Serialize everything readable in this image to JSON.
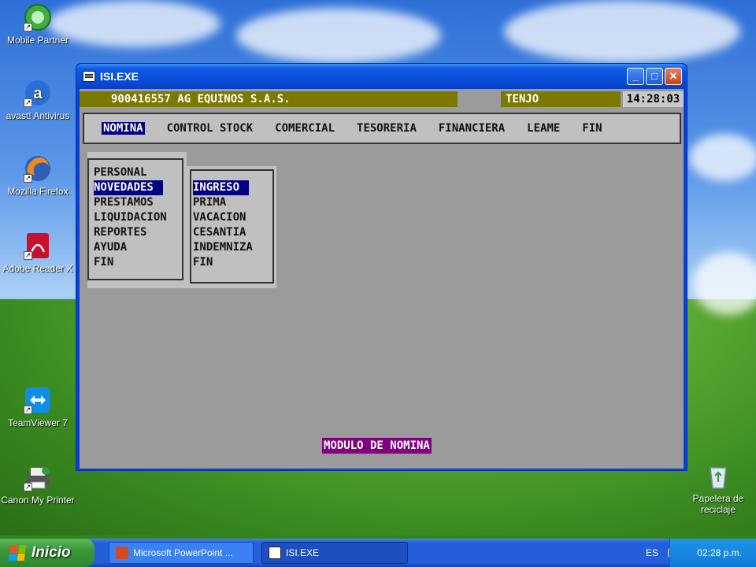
{
  "desktop": {
    "icons": [
      {
        "label": "Mobile Partner",
        "icon": "mobile-partner-icon"
      },
      {
        "label": "avast! Antivirus",
        "icon": "avast-icon"
      },
      {
        "label": "Mozilla Firefox",
        "icon": "firefox-icon"
      },
      {
        "label": "Adobe Reader X",
        "icon": "adobe-reader-icon"
      },
      {
        "label": "TeamViewer 7",
        "icon": "teamviewer-icon"
      },
      {
        "label": "Canon My Printer",
        "icon": "printer-icon"
      },
      {
        "label": "Papelera de reciclaje",
        "icon": "recycle-bin-icon"
      }
    ]
  },
  "window": {
    "title": "ISI.EXE",
    "controls": {
      "minimize": "_",
      "maximize": "□",
      "close": "✕"
    }
  },
  "app": {
    "company": "900416557 AG EQUINOS S.A.S.",
    "location": "TENJO",
    "clock": "14:28:03",
    "menu": [
      "NOMINA",
      "CONTROL STOCK",
      "COMERCIAL",
      "TESORERIA",
      "FINANCIERA",
      "LEAME",
      "FIN"
    ],
    "active_menu": "NOMINA",
    "submenu": [
      "PERSONAL",
      "NOVEDADES",
      "PRESTAMOS",
      "LIQUIDACION",
      "REPORTES",
      "AYUDA",
      "FIN"
    ],
    "submenu_selected": "NOVEDADES",
    "subsubmenu": [
      "INGRESO",
      "PRIMA",
      "VACACION",
      "CESANTIA",
      "INDEMNIZA",
      "FIN"
    ],
    "subsubmenu_selected": "INGRESO",
    "status": "MODULO DE NOMINA"
  },
  "taskbar": {
    "start_label": "Inicio",
    "buttons": [
      {
        "label": "Microsoft PowerPoint ...",
        "icon": "powerpoint-icon",
        "active": false
      },
      {
        "label": "ISI.EXE",
        "icon": "console-icon",
        "active": true
      }
    ],
    "language": "ES",
    "time": "02:28 p.m."
  },
  "colors": {
    "menu_highlight": "#000080",
    "header_bar": "#7a7a00",
    "status_bar": "#800080",
    "console_bg": "#9b9b9b"
  }
}
